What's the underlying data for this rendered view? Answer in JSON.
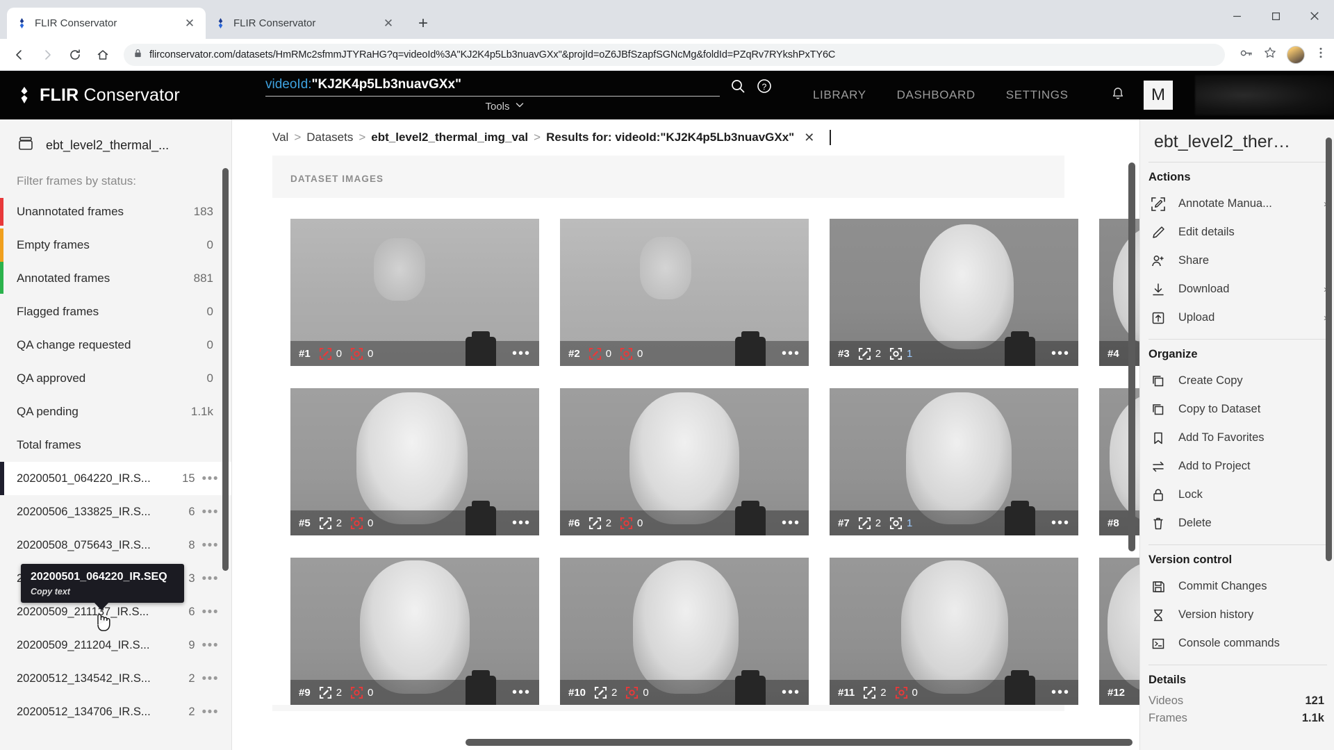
{
  "browser": {
    "tabs": [
      {
        "title": "FLIR Conservator",
        "active": true
      },
      {
        "title": "FLIR Conservator",
        "active": false
      }
    ],
    "new_tab_label": "+",
    "close_label": "✕",
    "window_controls": {
      "minimize": "─",
      "maximize": "☐",
      "close": "✕"
    },
    "url": "flirconservator.com/datasets/HmRMc2sfmmJTYRaHG?q=videoId%3A\"KJ2K4p5Lb3nuavGXx\"&projId=oZ6JBfSzapfSGNcMg&foldId=PZqRv7RYkshPxTY6C",
    "nav": {
      "back": "←",
      "forward": "→",
      "reload": "⟳",
      "home": "⌂"
    }
  },
  "appbar": {
    "brand": {
      "name_bold": "FLIR",
      "name_light": " Conservator"
    },
    "search": {
      "key": "videoId:",
      "value": "\"KJ2K4p5Lb3nuavGXx\"",
      "tools_label": "Tools"
    },
    "nav_links": [
      {
        "label": "LIBRARY"
      },
      {
        "label": "DASHBOARD"
      },
      {
        "label": "SETTINGS"
      }
    ],
    "avatar_initial": "M"
  },
  "sidebar": {
    "dataset_name": "ebt_level2_thermal_...",
    "filter_label": "Filter frames by status:",
    "statuses": [
      {
        "label": "Unannotated frames",
        "count": "183",
        "color": "#e8393a"
      },
      {
        "label": "Empty frames",
        "count": "0",
        "color": "#f0a01e"
      },
      {
        "label": "Annotated frames",
        "count": "881",
        "color": "#2bb24c"
      },
      {
        "label": "Flagged frames",
        "count": "0",
        "color": "transparent"
      },
      {
        "label": "QA change requested",
        "count": "0",
        "color": "transparent"
      },
      {
        "label": "QA approved",
        "count": "0",
        "color": "transparent"
      },
      {
        "label": "QA pending",
        "count": "1.1k",
        "color": "transparent"
      },
      {
        "label": "Total frames",
        "count": "",
        "color": "transparent"
      }
    ],
    "tooltip": {
      "title": "20200501_064220_IR.SEQ",
      "action": "Copy text"
    },
    "videos": [
      {
        "name": "20200501_064220_IR.S...",
        "count": "15",
        "active": true
      },
      {
        "name": "20200506_133825_IR.S...",
        "count": "6",
        "active": false
      },
      {
        "name": "20200508_075643_IR.S...",
        "count": "8",
        "active": false
      },
      {
        "name": "20200509_211120_IR.S...",
        "count": "3",
        "active": false
      },
      {
        "name": "20200509_211137_IR.S...",
        "count": "6",
        "active": false
      },
      {
        "name": "20200509_211204_IR.S...",
        "count": "9",
        "active": false
      },
      {
        "name": "20200512_134542_IR.S...",
        "count": "2",
        "active": false
      },
      {
        "name": "20200512_134706_IR.S...",
        "count": "2",
        "active": false
      }
    ],
    "overflow_dots": "•••"
  },
  "breadcrumb": {
    "items": [
      {
        "label": "Val",
        "bold": false
      },
      {
        "label": "Datasets",
        "bold": false
      },
      {
        "label": "ebt_level2_thermal_img_val",
        "bold": true
      },
      {
        "label": "Results for: videoId:\"KJ2K4p5Lb3nuavGXx\"",
        "bold": true
      }
    ],
    "separator": ">",
    "clear_label": "✕"
  },
  "gallery": {
    "panel_title": "DATASET IMAGES",
    "overflow_dots": "•••",
    "cards": [
      {
        "index": "#1",
        "edit_count": "0",
        "target_count": "0",
        "red": true,
        "tone": "hand"
      },
      {
        "index": "#2",
        "edit_count": "0",
        "target_count": "0",
        "red": true,
        "tone": "hand"
      },
      {
        "index": "#3",
        "edit_count": "2",
        "target_count": "1",
        "red": false,
        "tone": "side"
      },
      {
        "index": "#4",
        "edit_count": "",
        "target_count": "",
        "red": false,
        "tone": "side"
      },
      {
        "index": "#5",
        "edit_count": "2",
        "target_count": "0",
        "red": false,
        "tone": "face"
      },
      {
        "index": "#6",
        "edit_count": "2",
        "target_count": "0",
        "red": false,
        "tone": "face"
      },
      {
        "index": "#7",
        "edit_count": "2",
        "target_count": "1",
        "red": false,
        "tone": "side"
      },
      {
        "index": "#8",
        "edit_count": "",
        "target_count": "",
        "red": false,
        "tone": "face"
      },
      {
        "index": "#9",
        "edit_count": "2",
        "target_count": "0",
        "red": false,
        "tone": "face"
      },
      {
        "index": "#10",
        "edit_count": "2",
        "target_count": "0",
        "red": false,
        "tone": "face"
      },
      {
        "index": "#11",
        "edit_count": "2",
        "target_count": "0",
        "red": false,
        "tone": "face"
      },
      {
        "index": "#12",
        "edit_count": "",
        "target_count": "",
        "red": false,
        "tone": "face"
      }
    ]
  },
  "rightpanel": {
    "title": "ebt_level2_ther…",
    "sections": [
      {
        "heading": "Actions",
        "items": [
          {
            "label": "Annotate Manua...",
            "icon": "annotate-icon",
            "chevron": "›"
          },
          {
            "label": "Edit details",
            "icon": "pencil-icon",
            "chevron": ""
          },
          {
            "label": "Share",
            "icon": "share-icon",
            "chevron": ""
          },
          {
            "label": "Download",
            "icon": "download-icon",
            "chevron": "›"
          },
          {
            "label": "Upload",
            "icon": "upload-icon",
            "chevron": "›"
          }
        ]
      },
      {
        "heading": "Organize",
        "items": [
          {
            "label": "Create Copy",
            "icon": "copy-icon",
            "chevron": ""
          },
          {
            "label": "Copy to Dataset",
            "icon": "copy-icon",
            "chevron": ""
          },
          {
            "label": "Add To Favorites",
            "icon": "bookmark-icon",
            "chevron": ""
          },
          {
            "label": "Add to Project",
            "icon": "move-icon",
            "chevron": ""
          },
          {
            "label": "Lock",
            "icon": "lock-icon",
            "chevron": ""
          },
          {
            "label": "Delete",
            "icon": "trash-icon",
            "chevron": ""
          }
        ]
      },
      {
        "heading": "Version control",
        "items": [
          {
            "label": "Commit Changes",
            "icon": "save-icon",
            "chevron": ""
          },
          {
            "label": "Version history",
            "icon": "hourglass-icon",
            "chevron": ""
          },
          {
            "label": "Console commands",
            "icon": "terminal-icon",
            "chevron": ""
          }
        ]
      }
    ],
    "details_heading": "Details",
    "details": [
      {
        "key": "Videos",
        "value": "121"
      },
      {
        "key": "Frames",
        "value": "1.1k"
      }
    ]
  }
}
